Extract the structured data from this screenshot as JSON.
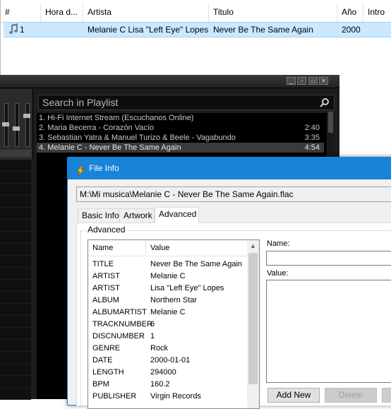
{
  "listview": {
    "columns": [
      "#",
      "Hora d...",
      "Artista",
      "Titulo",
      "Año",
      "Intro"
    ],
    "row": {
      "num": "1",
      "hora": "",
      "artista": "Melanie C Lisa \"Left Eye\" Lopes",
      "titulo": "Never Be The Same Again",
      "anio": "2000",
      "intro": ""
    }
  },
  "winamp": {
    "search_placeholder": "Search in Playlist",
    "items": [
      {
        "text": "1. Hi-Fi Internet Stream (Escuchanos Online)",
        "dur": ""
      },
      {
        "text": "2. Maria Becerra - Corazón Vacío",
        "dur": "2:40"
      },
      {
        "text": "3. Sebastian Yatra & Manuel Turizo & Beele - Vagabundo",
        "dur": "3:35"
      },
      {
        "text": "4. Melanie C - Never Be The Same Again",
        "dur": "4:54"
      }
    ],
    "colors": {
      "bg": "#000000",
      "text": "#c8c8c8",
      "selected": "#3a3a3a"
    }
  },
  "dialog": {
    "title": "File Info",
    "path": "M:\\Mi musica\\Melanie C - Never Be The Same Again.flac",
    "tabs": [
      "Basic Info",
      "Artwork",
      "Advanced"
    ],
    "active_tab": "Advanced",
    "group_label": "Advanced",
    "metadata_headers": {
      "name": "Name",
      "value": "Value"
    },
    "metadata": [
      {
        "name": "TITLE",
        "value": "Never Be The Same Again"
      },
      {
        "name": "ARTIST",
        "value": "Melanie C"
      },
      {
        "name": "ARTIST",
        "value": "Lisa \"Left Eye\" Lopes"
      },
      {
        "name": "ALBUM",
        "value": "Northern Star"
      },
      {
        "name": "ALBUMARTIST",
        "value": "Melanie C"
      },
      {
        "name": "TRACKNUMBER",
        "value": "6"
      },
      {
        "name": "DISCNUMBER",
        "value": "1"
      },
      {
        "name": "GENRE",
        "value": "Rock"
      },
      {
        "name": "DATE",
        "value": "2000-01-01"
      },
      {
        "name": "LENGTH",
        "value": "294000"
      },
      {
        "name": "BPM",
        "value": "160.2"
      },
      {
        "name": "PUBLISHER",
        "value": "Virgin Records"
      }
    ],
    "name_label": "Name:",
    "value_label": "Value:",
    "add_new_label": "Add New",
    "delete_label": "Delete",
    "title_color": "#1883d7"
  }
}
